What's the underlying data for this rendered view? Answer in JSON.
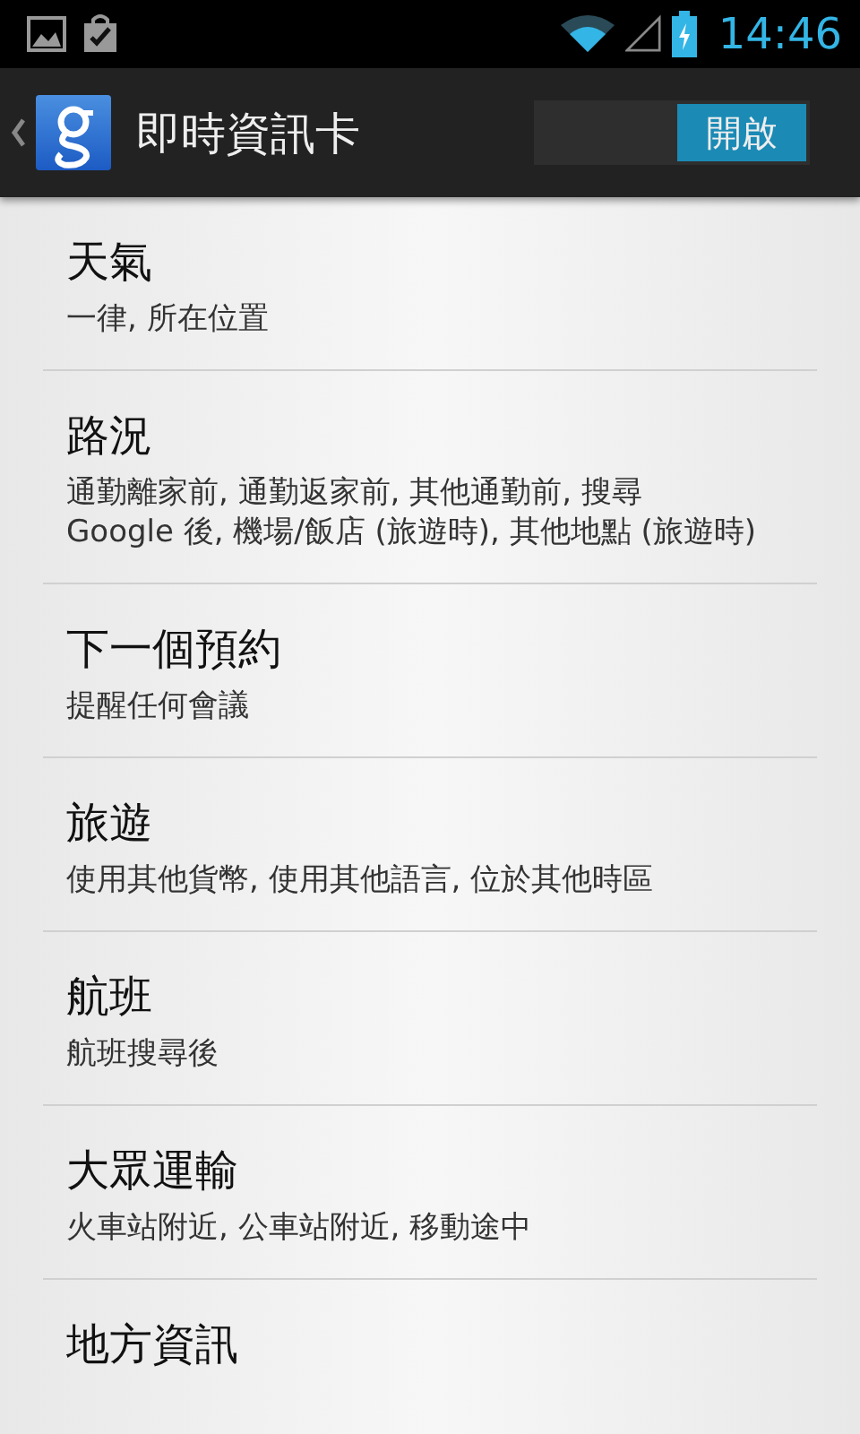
{
  "status_bar": {
    "time": "14:46"
  },
  "action_bar": {
    "title": "即時資訊卡",
    "switch": {
      "label": "開啟",
      "on": true
    }
  },
  "items": [
    {
      "title": "天氣",
      "subtitle": "一律, 所在位置"
    },
    {
      "title": "路況",
      "subtitle": "通勤離家前, 通勤返家前, 其他通勤前, 搜尋 Google 後, 機場/飯店 (旅遊時), 其他地點 (旅遊時)"
    },
    {
      "title": "下一個預約",
      "subtitle": "提醒任何會議"
    },
    {
      "title": "旅遊",
      "subtitle": "使用其他貨幣, 使用其他語言, 位於其他時區"
    },
    {
      "title": "航班",
      "subtitle": "航班搜尋後"
    },
    {
      "title": "大眾運輸",
      "subtitle": "火車站附近, 公車站附近, 移動途中"
    },
    {
      "title": "地方資訊"
    }
  ]
}
